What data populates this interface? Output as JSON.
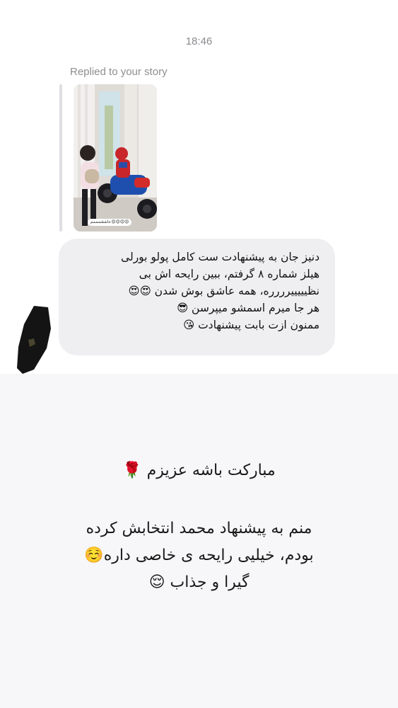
{
  "chat": {
    "timestamp": "18:46",
    "reply_label": "Replied to your story",
    "story_sticker_text": "عاشقتمممم😍😍😍😍",
    "message_lines": [
      "دنیز جان به پیشنهادت ست کامل پولو بورلی",
      "هیلز شماره ۸ گرفتم، ببین رایحه اش بی",
      "نظیییییرررره، همه عاشق بوش شدن 😍😍",
      "هر جا میرم اسمشو میپرسن 😎",
      "ممنون ازت بابت پیشنهادت 😘"
    ]
  },
  "caption": {
    "congrats": "مبارکت باشه عزیزم 🌹",
    "body_lines": [
      "منم به پیشنهاد محمد انتخابش کرده",
      "بودم، خیلیی رایحه ی خاصی داره☺️",
      "گیرا و جذاب 😌"
    ]
  },
  "colors": {
    "page_background": "#f7f7f9",
    "card_background": "#ffffff",
    "bubble_background": "#efeff2",
    "meta_text": "#8e8e93",
    "message_text": "#121212"
  }
}
